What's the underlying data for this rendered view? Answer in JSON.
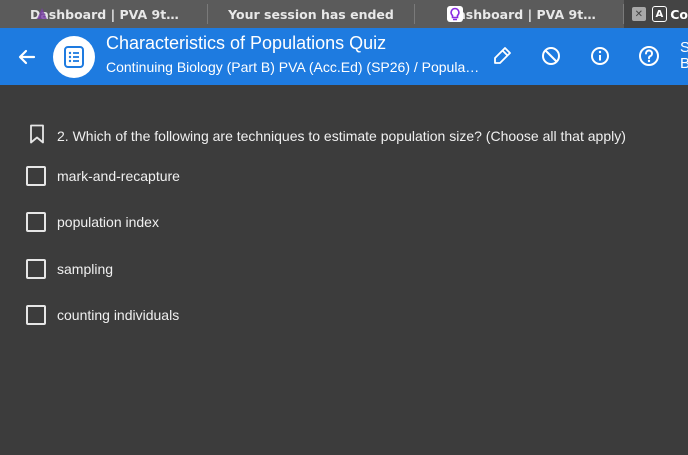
{
  "browser": {
    "tabs": [
      {
        "label": "Dashboard | PVA 9t…",
        "icon": "purple-app-icon"
      },
      {
        "label": "Your session has ended",
        "icon": ""
      },
      {
        "label": "Dashboard | PVA 9t…",
        "icon": "lightbulb-icon"
      },
      {
        "label": "Co",
        "icon": "a-box-icon"
      }
    ]
  },
  "header": {
    "title": "Characteristics of Populations Quiz",
    "subtitle": "Continuing Biology (Part B) PVA (Acc.Ed) (SP26) / Popula…",
    "edge_text": "S B",
    "accent_color": "#1e7be0"
  },
  "question": {
    "text": "2. Which of the following are techniques to estimate population size? (Choose all that apply)",
    "options": [
      {
        "label": "mark-and-recapture",
        "checked": false
      },
      {
        "label": "population index",
        "checked": false
      },
      {
        "label": "sampling",
        "checked": false
      },
      {
        "label": "counting individuals",
        "checked": false
      }
    ]
  }
}
